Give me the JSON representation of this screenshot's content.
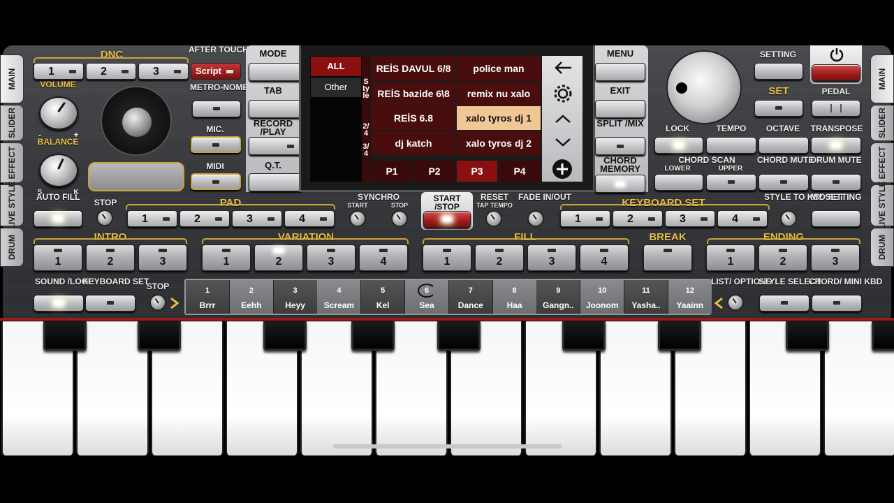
{
  "tabs_left": [
    "MAIN",
    "SLIDER",
    "EFFECT",
    "LIVE STYLE",
    "DRUM"
  ],
  "tabs_right": [
    "MAIN",
    "SLIDER",
    "EFFECT",
    "LIVE STYLE",
    "DRUM"
  ],
  "left": {
    "dnc": "DNC",
    "after_touch": "AFTER TOUCH",
    "script": "Script",
    "dnc_buttons": [
      "1",
      "2",
      "3"
    ],
    "volume": "VOLUME",
    "balance": "BALANCE",
    "s": "S",
    "k": "K",
    "minus": "-",
    "plus": "+",
    "metronome": "METRO-NOME",
    "mic": "MIC.",
    "midi": "MIDI"
  },
  "center_left": {
    "mode": "MODE",
    "tab": "TAB",
    "record_play": "RECORD /PLAY",
    "qt": "Q.T."
  },
  "display": {
    "filters": [
      "ALL",
      "Other"
    ],
    "side_label": "Style",
    "meters": [
      "2/4",
      "3/4"
    ],
    "styles": [
      "REİS DAVUL 6/8",
      "police man",
      "REİS bazide 6\\8",
      "remix nu xalo",
      "REİS 6.8",
      "xalo tyros dj 1",
      "dj katch",
      "xalo tyros dj 2"
    ],
    "selected_style": "xalo tyros dj 1",
    "pages": [
      "P1",
      "P2",
      "P3",
      "P4"
    ],
    "selected_page": "P3"
  },
  "center_right": {
    "menu": "MENU",
    "exit": "EXIT",
    "split_mix": "SPLIT /MIX",
    "chord_memory": "CHORD MEMORY"
  },
  "right": {
    "setting": "SETTING",
    "set": "SET",
    "pedal": "PEDAL",
    "lock": "LOCK",
    "tempo": "TEMPO",
    "octave": "OCTAVE",
    "transpose": "TRANSPOSE",
    "chord_scan": "CHORD SCAN",
    "lower": "LOWER",
    "upper": "UPPER",
    "chord_mute": "CHORD MUTE",
    "drum_mute": "DRUM MUTE",
    "style_to_kbd": "STYLE TO KBD SET",
    "my_setting": "MY SETTING"
  },
  "row3": {
    "auto_fill": "AUTO FILL",
    "stop": "STOP",
    "pad": "PAD",
    "pad_buttons": [
      "1",
      "2",
      "3",
      "4"
    ],
    "synchro": "SYNCHRO",
    "start": "START",
    "stop2": "STOP",
    "start_stop": "START /STOP",
    "reset": "RESET",
    "tap_tempo": "TAP TEMPO",
    "fade": "FADE IN/OUT",
    "keyboard_set": "KEYBOARD SET",
    "kbd_buttons": [
      "1",
      "2",
      "3",
      "4"
    ]
  },
  "row4": {
    "intro": "INTRO",
    "intro_buttons": [
      "1",
      "2",
      "3"
    ],
    "variation": "VARIATION",
    "variation_buttons": [
      "1",
      "2",
      "3",
      "4"
    ],
    "fill": "FILL",
    "fill_buttons": [
      "1",
      "2",
      "3",
      "4"
    ],
    "break": "BREAK",
    "ending": "ENDING",
    "ending_buttons": [
      "1",
      "2",
      "3"
    ]
  },
  "row5": {
    "sound_loop": "SOUND /LOOP",
    "keyboard_set": "KEYBOARD SET",
    "stop": "STOP",
    "list_options": "LIST/ OPTIONS",
    "style_select": "STYLE SELECT",
    "chord_mini": "CHORD/ MINI KBD"
  },
  "sound_pads": [
    {
      "n": "1",
      "l": "Brrr"
    },
    {
      "n": "2",
      "l": "Eehh"
    },
    {
      "n": "3",
      "l": "Heyy"
    },
    {
      "n": "4",
      "l": "Scream"
    },
    {
      "n": "5",
      "l": "Kel"
    },
    {
      "n": "6",
      "l": "Sea"
    },
    {
      "n": "7",
      "l": "Dance"
    },
    {
      "n": "8",
      "l": "Haa"
    },
    {
      "n": "9",
      "l": "Gangn.."
    },
    {
      "n": "10",
      "l": "Joonom"
    },
    {
      "n": "11",
      "l": "Yasha.."
    },
    {
      "n": "12",
      "l": "Yaainn"
    }
  ],
  "colors": {
    "accent_gold": "#c9a238",
    "display_cell": "#4a0d0d",
    "selected_cell": "#f2c796",
    "active_red": "#9e1b1b"
  }
}
